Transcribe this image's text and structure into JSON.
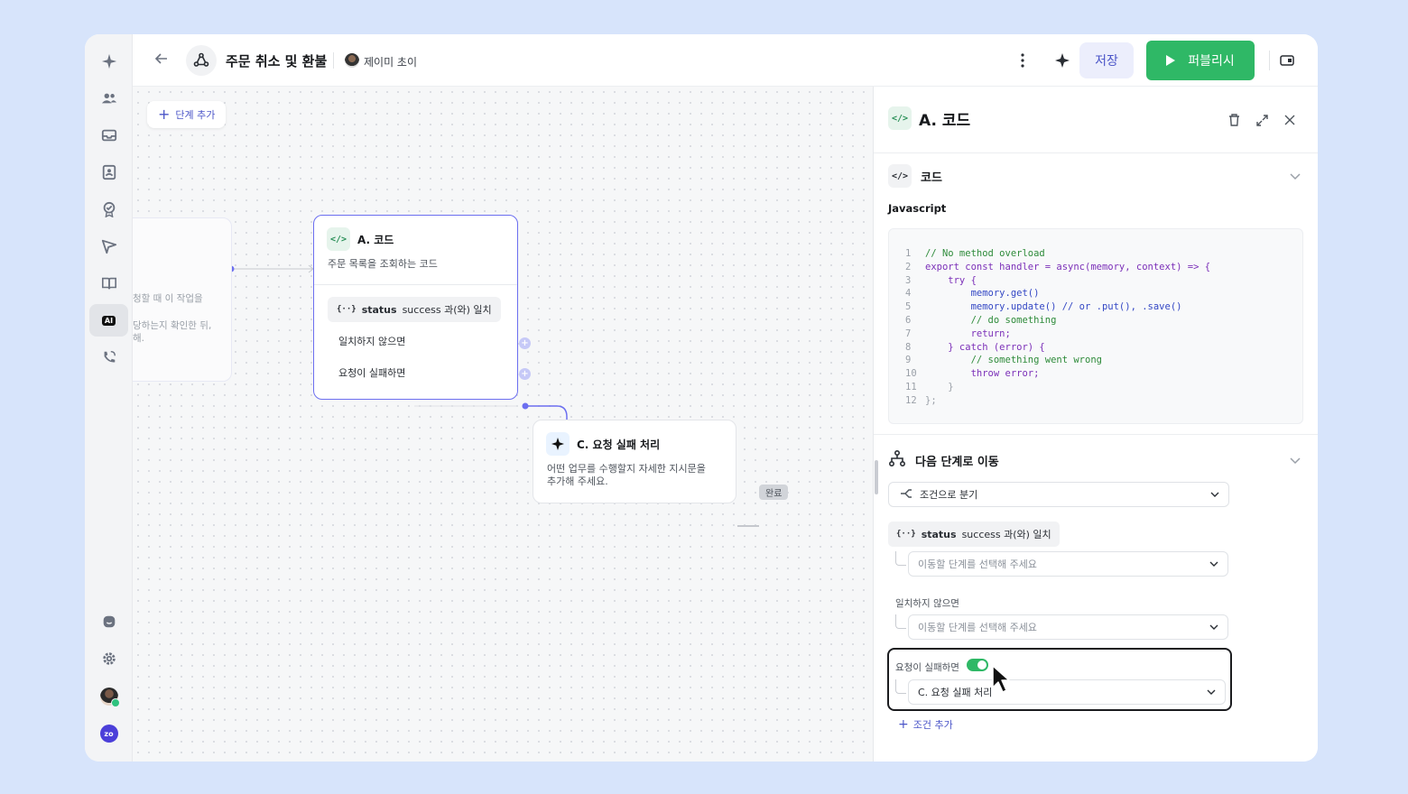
{
  "header": {
    "title": "주문 취소 및 환불",
    "user_name": "제이미 초이",
    "save_label": "저장",
    "publish_label": "퍼블리시"
  },
  "canvas": {
    "add_step_label": "단계 추가",
    "ghost_lines": [
      "청할 때 이 작업을",
      "당하는지 확인한 뒤,",
      "해."
    ],
    "node_a": {
      "title": "A. 코드",
      "description": "주문 목록을 조회하는 코드",
      "condition_var": "status",
      "condition_text": "success 과(와) 일치",
      "branch_else": "일치하지 않으면",
      "branch_fail": "요청이 실패하면"
    },
    "node_c": {
      "title": "C. 요청 실패 처리",
      "description_line1": "어떤 업무를 수행할지 자세한 지시문을",
      "description_line2": "추가해 주세요."
    },
    "done_label": "완료"
  },
  "panel": {
    "title": "A. 코드",
    "code_section_title": "코드",
    "language": "Javascript",
    "code_lines": [
      "// No method overload",
      "export const handler = async(memory, context) => {",
      "    try {",
      "        memory.get()",
      "        memory.update() // or .put(), .save()",
      "        // do something",
      "        return;",
      "    } catch (error) {",
      "        // something went wrong",
      "        throw error;",
      "    }",
      "};"
    ],
    "next_section_title": "다음 단계로 이동",
    "branch_mode": "조건으로 분기",
    "condition_var": "status",
    "condition_text": "success 과(와) 일치",
    "target_placeholder": "이동할 단계를 선택해 주세요",
    "else_label": "일치하지 않으면",
    "fail_label": "요청이 실패하면",
    "fail_toggle_on": true,
    "fail_target": "C. 요청 실패 처리",
    "add_condition_label": "조건 추가"
  },
  "colors": {
    "accent": "#6c6ff0",
    "publish": "#2fb866",
    "background": "#d7e4fb"
  }
}
